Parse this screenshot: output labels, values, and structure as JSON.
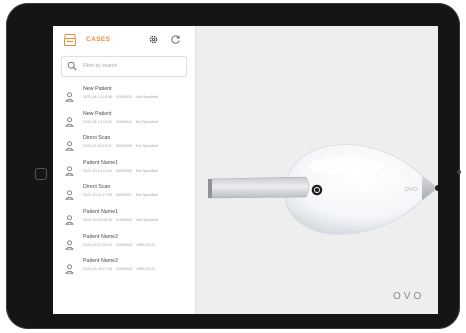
{
  "sidebar": {
    "title": "CASES",
    "icons": {
      "cases": "cases-icon",
      "settings": "gear-icon",
      "refresh": "refresh-icon",
      "search": "search-icon",
      "patient": "person-icon"
    },
    "search": {
      "placeholder": "Filter by search",
      "value": ""
    },
    "patients": [
      {
        "name": "New Patient",
        "datetime": "2022-04-13 15:39",
        "id": "ID000020",
        "dob": "Not Specified"
      },
      {
        "name": "New Patient",
        "datetime": "2022-04-13 15:22",
        "id": "ID000011",
        "dob": "Not Specified"
      },
      {
        "name": "Direct Scan",
        "datetime": "2022-11-08 15:37",
        "id": "ID000008",
        "dob": "Not Specified"
      },
      {
        "name": "Patient Name1",
        "datetime": "2022-10-14 11:02",
        "id": "ID000005",
        "dob": "Not Specified"
      },
      {
        "name": "Direct Scan",
        "datetime": "2022-10-11 17:05",
        "id": "ID000007",
        "dob": "Not Specified"
      },
      {
        "name": "Patient Name1",
        "datetime": "2022-10-04 09:39",
        "id": "ID000003",
        "dob": "Not Specified"
      },
      {
        "name": "Patient Name2",
        "datetime": "2022-09-27 09:41",
        "id": "ID000004",
        "dob": "1986-02-22"
      },
      {
        "name": "Patient Name2",
        "datetime": "2022-09-26 17:29",
        "id": "ID000004",
        "dob": "1986-02-22"
      }
    ]
  },
  "viewport": {
    "device_label": "OVO",
    "brand": "OVO"
  },
  "colors": {
    "accent": "#e58b3c",
    "screen_bg": "#eeeeee",
    "sidebar_bg": "#ffffff",
    "bezel": "#151515"
  }
}
